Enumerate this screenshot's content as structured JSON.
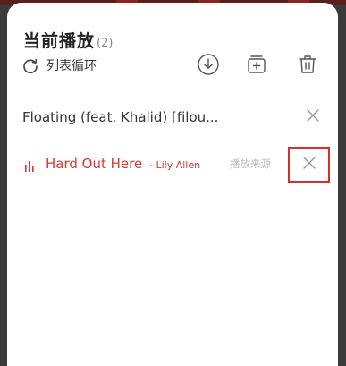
{
  "header": {
    "title": "当前播放",
    "count": "(2)"
  },
  "mode": {
    "label": "列表循环",
    "icon": "repeat-icon"
  },
  "toolbar": {
    "icons": [
      "download-icon",
      "add-to-playlist-icon",
      "trash-icon"
    ]
  },
  "songs": [
    {
      "title": "Floating (feat. Khalid) [filou...",
      "artist": "",
      "source": "",
      "playing": false
    },
    {
      "title": "Hard Out Here",
      "artist": "- Lily Allen",
      "source": "播放来源",
      "playing": true
    }
  ],
  "colors": {
    "accent": "#d33a31",
    "highlight": "#d42e2e",
    "text": "#333333",
    "muted": "#b9b9b9"
  }
}
